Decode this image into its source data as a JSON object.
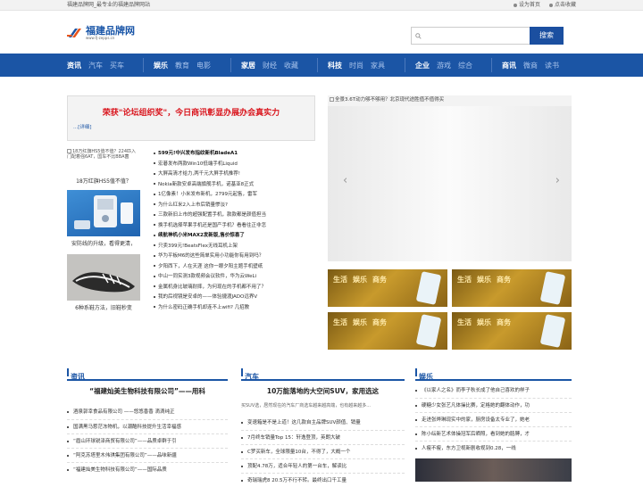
{
  "topbar": {
    "left_text": "福建品牌网_最专业的福建品牌网站",
    "set_home": "设为首页",
    "bookmark": "点击收藏"
  },
  "logo": {
    "name": "福建品牌网",
    "url": "www.fj-zepps.cn"
  },
  "search": {
    "placeholder": "",
    "button": "搜索"
  },
  "nav": [
    {
      "lead": "资讯",
      "subs": [
        "汽车",
        "买车"
      ]
    },
    {
      "lead": "娱乐",
      "subs": [
        "教育",
        "电影"
      ]
    },
    {
      "lead": "家居",
      "subs": [
        "财经",
        "收藏"
      ]
    },
    {
      "lead": "科技",
      "subs": [
        "时尚",
        "家具"
      ]
    },
    {
      "lead": "企业",
      "subs": [
        "游戏",
        "综合"
      ]
    },
    {
      "lead": "商讯",
      "subs": [
        "微商",
        "读书"
      ]
    }
  ],
  "headline": {
    "title": "荣获\"论坛组织奖\"，今日商讯彰显办展办会真实力",
    "more": "...[详细]"
  },
  "left_thumbs": [
    {
      "alt": "18万红旗HS5值不值？224匹入门配着强6AT，国车不比BBA菌",
      "caption": "18万红旗HS5值不值？"
    },
    {
      "caption": "安防线的升级，看得更清，"
    },
    {
      "caption": "6种系鞋方法，旧鞋秒变"
    }
  ],
  "news_list": [
    {
      "text": "599元!中兴发布指纹新机BladeA1",
      "bold": true
    },
    {
      "text": "宏碁发布两款Win10低端手机Liquid",
      "bold": false
    },
    {
      "text": "大屏高清才给力,两千元大屏手机推荐!",
      "bold": false
    },
    {
      "text": "Nokia新款安卓高端旗舰手机，诺基亚8正式",
      "bold": false
    },
    {
      "text": "1亿像素！小米发布新机，2799元起售，雷军",
      "bold": false
    },
    {
      "text": "为什么红米2入上市后销量惨淡?",
      "bold": false
    },
    {
      "text": "三款新旧上市的超强配置手机，款款都是颜值担当",
      "bold": false
    },
    {
      "text": "换手机选择苹果手机还是国产手机？看看往正非怎",
      "bold": false
    },
    {
      "text": "续航神机小米MAX2发新版,售价惊喜了",
      "bold": true
    },
    {
      "text": "只卖399元!BeatsFlex无线耳机上架",
      "bold": false
    },
    {
      "text": "华为平板M6的这些简单实用小功能你有用到吗？",
      "bold": false
    },
    {
      "text": "夕阳西下，人在天涯 这你一眼夕阳主题手机壁纸",
      "bold": false
    },
    {
      "text": "中山一同实测3款视频会议软件，华为云WeLi",
      "bold": false
    },
    {
      "text": "金属机身比玻璃耐摔，为何现在的手机都不用了？",
      "bold": false
    },
    {
      "text": "我的后视镜是安卓的——体验捷渡JADO远界V",
      "bold": false
    },
    {
      "text": "为什么密码正确手机却连不上wifi? 几招教",
      "bold": false
    }
  ],
  "slider": {
    "caption": "全景3.6T动力够不够用？北京现代途胜值不值得买",
    "prev": "‹",
    "next": "›"
  },
  "gallery_labels": [
    "生活",
    "娱乐",
    "商务"
  ],
  "sections": [
    {
      "title": "资讯",
      "headline": "“福建灿美生物科技有限公司”——用科",
      "items": [
        "酒泉郭幸食品有限公司 ——悠悠香香 滴滴纯正",
        "国满黑马惹茫冻物机，以潮酷科技提升生活幸福感",
        "“眉山环球锐泽商贸有限公司”——品质卓群于引",
        "“阿克苏塔里木伟琪集团有限公司”——品味新疆",
        "“福建灿美生物科技有限公司”——国际品质"
      ]
    },
    {
      "title": "汽车",
      "headline": "10万能落地的大空间SUV，家用选这",
      "intro": "买SUV选，居然现在的汽车厂商选车越来越高端，也有越来越多...",
      "items": [
        "变速箱是不是上道！这几款自主品牌SUV颜值、销量",
        "7月终车销量Top 15：轩逸登顶，英朗大破",
        "C罗买新车，全球限量10台，不得了，大概一个",
        "顶配4.78万，适合年轻人的第一台车，解读比",
        "奇瑞瑞虎8 20.5万不行不转。最终出口千工量"
      ]
    },
    {
      "title": "娱乐",
      "items": [
        "《以家人之名》而李子秋长成了他自己喜欢的样子",
        "硬糖少女张艺凡体操比赛，定格她的翻体动作，功",
        "走进张晔琳现实中的家，厨房设备太专业了，她老",
        "陈小纭新艺术体操冠军后晒照，看到她的胳膊，才",
        "人瘦不瘦，东方卫视新剧收视到0.28，一线"
      ]
    }
  ]
}
